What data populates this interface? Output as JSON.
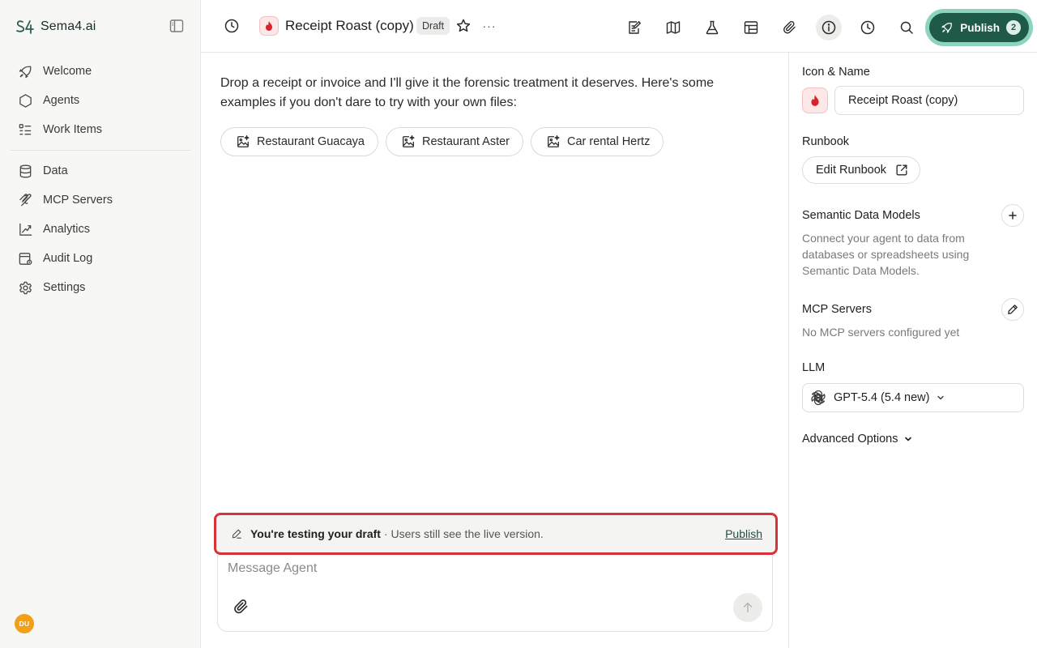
{
  "brand": {
    "name": "Sema4.ai"
  },
  "sidebar": {
    "primary": [
      {
        "label": "Welcome",
        "icon": "rocket-icon"
      },
      {
        "label": "Agents",
        "icon": "hexagon-icon"
      },
      {
        "label": "Work Items",
        "icon": "list-icon"
      }
    ],
    "secondary": [
      {
        "label": "Data",
        "icon": "database-icon"
      },
      {
        "label": "MCP Servers",
        "icon": "mcp-icon"
      },
      {
        "label": "Analytics",
        "icon": "analytics-icon"
      },
      {
        "label": "Audit Log",
        "icon": "audit-log-icon"
      },
      {
        "label": "Settings",
        "icon": "gear-icon"
      }
    ],
    "avatar_initials": "DU"
  },
  "header": {
    "agent_title": "Receipt Roast (copy)",
    "draft_badge": "Draft",
    "more_label": "···",
    "publish_label": "Publish",
    "publish_count": "2"
  },
  "chat": {
    "intro": "Drop a receipt or invoice and I'll give it the forensic treatment it deserves. Here's some examples if you don't dare to try with your own files:",
    "examples": [
      {
        "label": "Restaurant Guacaya"
      },
      {
        "label": "Restaurant Aster"
      },
      {
        "label": "Car rental Hertz"
      }
    ],
    "draft_notice_strong": "You're testing your draft",
    "draft_notice_rest": "· Users still see the live version.",
    "draft_notice_link": "Publish",
    "composer_placeholder": "Message Agent"
  },
  "panel": {
    "icon_name_label": "Icon & Name",
    "agent_name_value": "Receipt Roast (copy)",
    "runbook_label": "Runbook",
    "edit_runbook_label": "Edit Runbook",
    "sdm_label": "Semantic Data Models",
    "sdm_text": "Connect your agent to data from databases or spreadsheets using Semantic Data Models.",
    "mcp_label": "MCP Servers",
    "mcp_text": "No MCP servers configured yet",
    "llm_label": "LLM",
    "llm_value": "GPT-5.4 (5.4 new)",
    "advanced_label": "Advanced Options"
  },
  "colors": {
    "accent": "#1f5a49",
    "accent_glow": "#8dd3bf",
    "alert_border": "#d8323a",
    "avatar": "#f0a019"
  }
}
